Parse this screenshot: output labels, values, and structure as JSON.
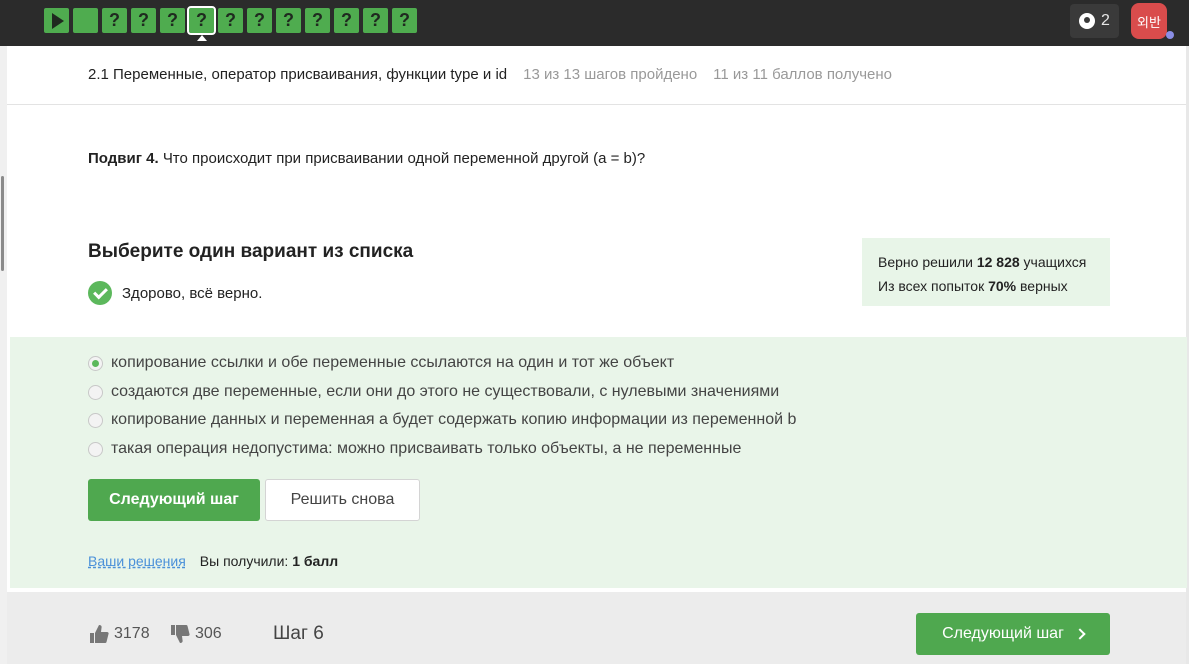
{
  "topbar": {
    "steps": [
      "",
      "",
      "?",
      "?",
      "?",
      "?",
      "?",
      "?",
      "?",
      "?",
      "?",
      "?",
      "?"
    ],
    "trophy_count": "2",
    "avatar_text": "외반"
  },
  "lesson": {
    "title": "2.1 Переменные, оператор присваивания, функции type и id",
    "progress": "13 из 13 шагов пройдено",
    "score": "11 из 11 баллов  получено"
  },
  "question": {
    "label": "Подвиг 4.",
    "text": "Что происходит при присваивании одной переменной другой (a = b)?"
  },
  "quiz": {
    "title": "Выберите один вариант из списка",
    "feedback": "Здорово, всё верно."
  },
  "stats": {
    "line1_prefix": "Верно решили ",
    "solved_count": "12 828",
    "line1_suffix": " учащихся",
    "line2_prefix": "Из всех попыток ",
    "percent": "70%",
    "line2_suffix": " верных"
  },
  "options": [
    {
      "label": "копирование ссылки и обе переменные ссылаются на один и тот же объект",
      "checked": true
    },
    {
      "label": "создаются две переменные, если они до этого не существовали, с нулевыми значениями",
      "checked": false
    },
    {
      "label": "копирование данных и переменная a будет содержать копию информации из переменной b",
      "checked": false
    },
    {
      "label": "такая операция недопустима: можно присваивать только объекты, а не переменные",
      "checked": false
    }
  ],
  "actions": {
    "next_label": "Следующий шаг",
    "retry_label": "Решить снова",
    "solutions_link": "Ваши решения",
    "result_prefix": "Вы получили: ",
    "result_value": "1 балл"
  },
  "footer": {
    "likes": "3178",
    "dislikes": "306",
    "step_label": "Шаг 6",
    "next_label": "Следующий шаг"
  },
  "colors": {
    "accent_green": "#4fa84f",
    "success_bg": "#e9f5e9",
    "topbar_bg": "#2b2b2b"
  }
}
